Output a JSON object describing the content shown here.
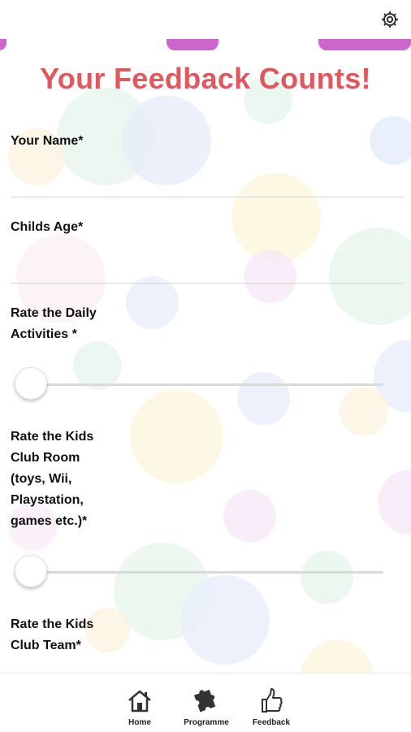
{
  "header": {
    "settings_icon": "gear-icon"
  },
  "form": {
    "title": "Your Feedback Counts!",
    "fields": [
      {
        "label": "Your Name*",
        "value": ""
      },
      {
        "label": "Childs Age*",
        "value": ""
      }
    ],
    "ratings": [
      {
        "label": "Rate the Daily Activities *",
        "value": 0
      },
      {
        "label": "Rate the Kids Club Room (toys, Wii, Playstation, games etc.)*",
        "value": 0
      },
      {
        "label": "Rate the Kids Club Team*"
      }
    ]
  },
  "bottom_nav": {
    "items": [
      {
        "label": "Home",
        "icon": "home-icon"
      },
      {
        "label": "Programme",
        "icon": "puzzle-icon"
      },
      {
        "label": "Feedback",
        "icon": "thumbs-up-icon"
      }
    ]
  },
  "colors": {
    "title": "#e0585e",
    "accent_tabs": "#cc66cc",
    "slider_track": "#d9d9d9"
  }
}
